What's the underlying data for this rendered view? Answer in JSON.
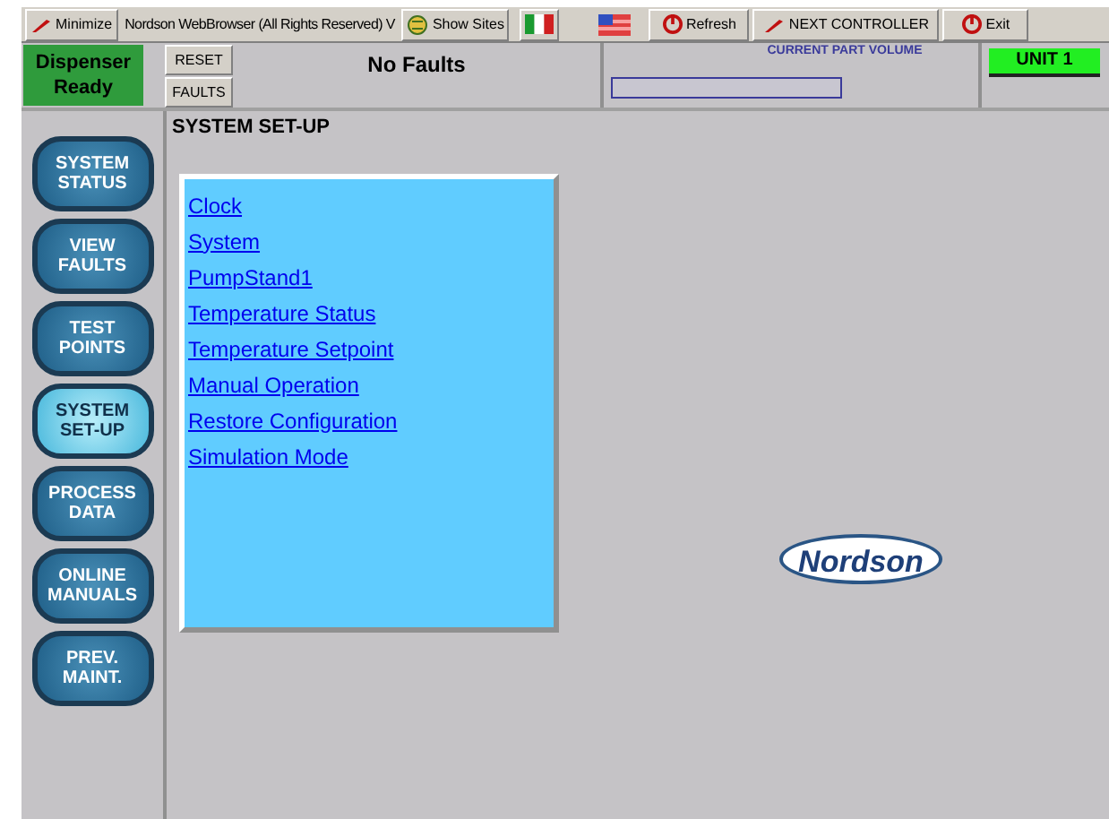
{
  "toolbar": {
    "minimize": "Minimize",
    "title": "Nordson WebBrowser (All Rights Reserved) V",
    "show_sites": "Show Sites",
    "refresh": "Refresh",
    "next_controller": "NEXT CONTROLLER",
    "exit": "Exit"
  },
  "status": {
    "dispenser": "Dispenser Ready",
    "reset": "RESET",
    "faults": "FAULTS",
    "message": "No Faults",
    "volume_label": "CURRENT PART VOLUME",
    "unit": "UNIT 1"
  },
  "nav": [
    {
      "label": "SYSTEM STATUS",
      "selected": false
    },
    {
      "label": "VIEW FAULTS",
      "selected": false
    },
    {
      "label": "TEST POINTS",
      "selected": false
    },
    {
      "label": "SYSTEM SET-UP",
      "selected": true
    },
    {
      "label": "PROCESS DATA",
      "selected": false
    },
    {
      "label": "ONLINE MANUALS",
      "selected": false
    },
    {
      "label": "PREV. MAINT.",
      "selected": false
    }
  ],
  "page_title": "SYSTEM SET-UP",
  "links": [
    "Clock",
    "System",
    "PumpStand1",
    "Temperature Status",
    "Temperature Setpoint",
    "Manual Operation",
    "Restore Configuration",
    "Simulation Mode"
  ],
  "logo": "Nordson"
}
